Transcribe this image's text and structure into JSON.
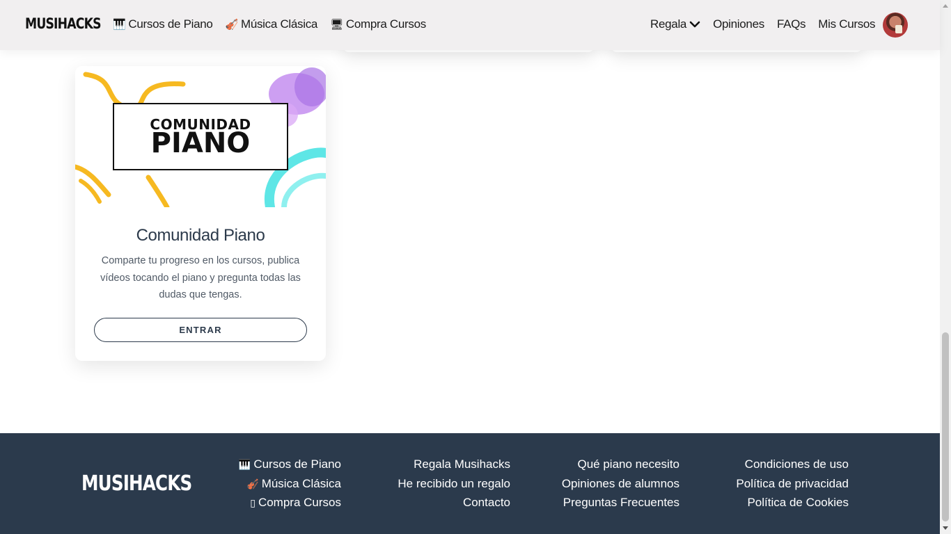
{
  "header": {
    "logo": "MUSIHACKS",
    "nav_left": [
      {
        "icon": "🎹",
        "icon_name": "piano-icon",
        "label": "Cursos de Piano"
      },
      {
        "icon": "🎻",
        "icon_name": "violin-icon",
        "label": "Música Clásica"
      },
      {
        "icon": "🖥",
        "icon_name": "course-icon",
        "label": "Compra Cursos"
      }
    ],
    "nav_right": [
      {
        "label": "Regala",
        "has_dropdown": true
      },
      {
        "label": "Opiniones"
      },
      {
        "label": "FAQs"
      },
      {
        "label": "Mis Cursos"
      }
    ],
    "avatar": "user-avatar"
  },
  "card": {
    "image_badge_top": "COMUNIDAD",
    "image_badge_main": "PIANO",
    "title": "Comunidad Piano",
    "description": "Comparte tu progreso en los cursos, publica vídeos tocando el piano y pregunta todas las dudas que tengas.",
    "button_label": "ENTRAR"
  },
  "footer": {
    "logo": "MUSIHACKS",
    "columns": [
      [
        {
          "icon": "🎹",
          "icon_name": "piano-icon",
          "label": "Cursos de Piano"
        },
        {
          "icon": "🎻",
          "icon_name": "violin-icon",
          "label": "Música Clásica"
        },
        {
          "icon": "▯",
          "icon_name": "course-icon",
          "label": "Compra Cursos"
        }
      ],
      [
        {
          "label": "Regala Musihacks"
        },
        {
          "label": "He recibido un regalo"
        },
        {
          "label": "Contacto"
        }
      ],
      [
        {
          "label": "Qué piano necesito"
        },
        {
          "label": "Opiniones de alumnos"
        },
        {
          "label": "Preguntas Frecuentes"
        }
      ],
      [
        {
          "label": "Condiciones de uso"
        },
        {
          "label": "Política de privacidad"
        },
        {
          "label": "Política de Cookies"
        }
      ]
    ]
  },
  "colors": {
    "header_bg": "#f1eff0",
    "footer_bg": "#2b3a4c",
    "text_dark": "#2c3a4b",
    "accent_yellow": "#f6b921",
    "accent_cyan": "#5ee6e6",
    "accent_purple": "#b67be8"
  }
}
